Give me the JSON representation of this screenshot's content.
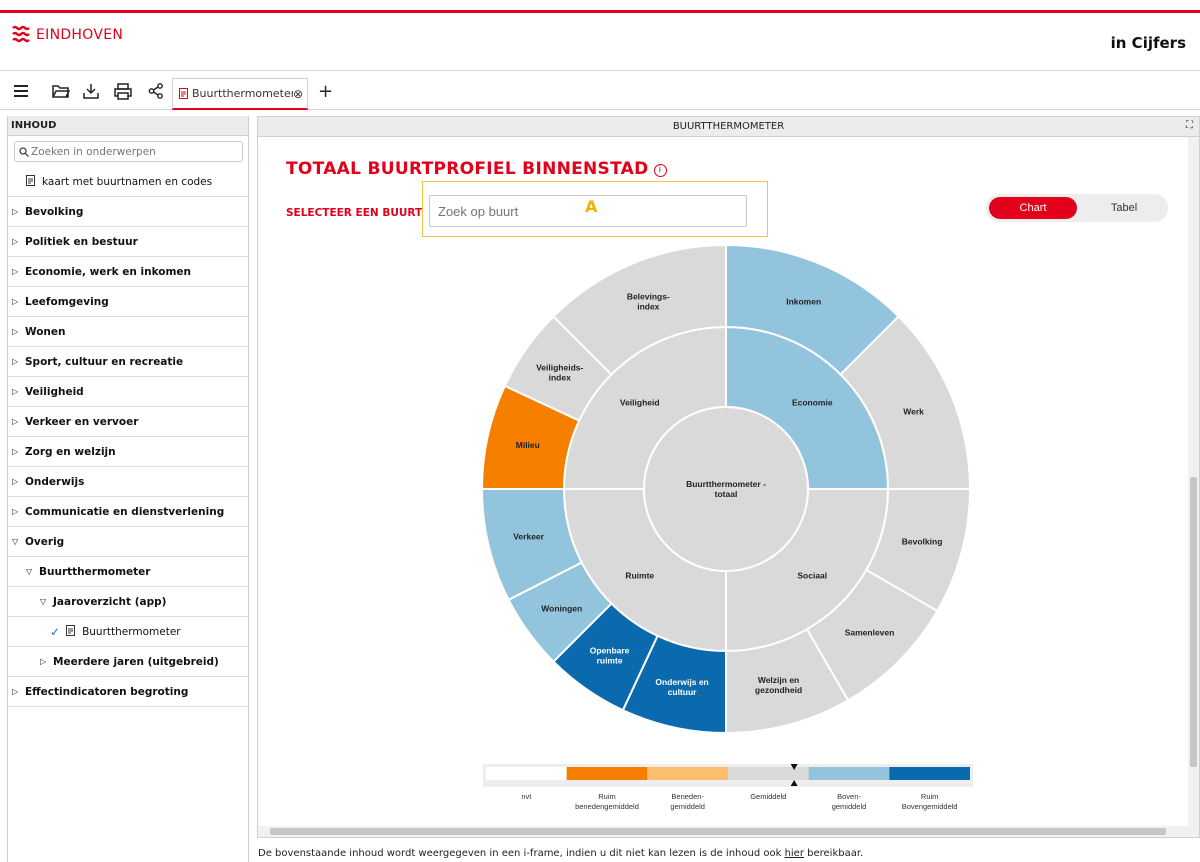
{
  "header": {
    "brand": "EINDHOVEN",
    "right_title": "in Cijfers"
  },
  "toolbar": {
    "icons": [
      "menu-icon",
      "folder-icon",
      "download-icon",
      "print-icon",
      "share-icon"
    ],
    "tab_label": "Buurtthermometer",
    "add_tab": "+"
  },
  "sidebar": {
    "heading": "INHOUD",
    "search_placeholder": "Zoeken in onderwerpen",
    "items": [
      {
        "label": "kaart met buurtnamen en codes",
        "kind": "doc"
      },
      {
        "label": "Bevolking",
        "kind": "collapsed"
      },
      {
        "label": "Politiek en bestuur",
        "kind": "collapsed"
      },
      {
        "label": "Economie, werk en inkomen",
        "kind": "collapsed"
      },
      {
        "label": "Leefomgeving",
        "kind": "collapsed"
      },
      {
        "label": "Wonen",
        "kind": "collapsed"
      },
      {
        "label": "Sport, cultuur en recreatie",
        "kind": "collapsed"
      },
      {
        "label": "Veiligheid",
        "kind": "collapsed"
      },
      {
        "label": "Verkeer en vervoer",
        "kind": "collapsed"
      },
      {
        "label": "Zorg en welzijn",
        "kind": "collapsed"
      },
      {
        "label": "Onderwijs",
        "kind": "collapsed"
      },
      {
        "label": "Communicatie en dienstverlening",
        "kind": "collapsed"
      },
      {
        "label": "Overig",
        "kind": "expanded"
      },
      {
        "label": "Buurtthermometer",
        "kind": "expanded"
      },
      {
        "label": "Jaaroverzicht (app)",
        "kind": "expanded"
      },
      {
        "label": "Buurtthermometer",
        "kind": "selected"
      },
      {
        "label": "Meerdere jaren (uitgebreid)",
        "kind": "collapsed"
      },
      {
        "label": "Effectindicatoren begroting",
        "kind": "collapsed"
      }
    ]
  },
  "panel": {
    "heading": "BUURTTHERMOMETER",
    "title": "TOTAAL BUURTPROFIEL BINNENSTAD",
    "select_label": "SELECTEER EEN BUURT",
    "select_placeholder": "Zoek op buurt",
    "marker": "A",
    "toggle_chart": "Chart",
    "toggle_table": "Tabel"
  },
  "chart_data": {
    "type": "sunburst",
    "center": "Buurtthermometer - totaal",
    "colors": {
      "nvt": "#ffffff",
      "ruim_beneden": "#f77f00",
      "beneden": "#fdbf6f",
      "gemiddeld": "#d9d9d9",
      "boven": "#93c4de",
      "ruim_boven": "#0b6aad"
    },
    "inner": [
      {
        "label": "Economie",
        "start": 0,
        "end": 90,
        "class": "boven"
      },
      {
        "label": "Sociaal",
        "start": 90,
        "end": 180,
        "class": "gemiddeld"
      },
      {
        "label": "Ruimte",
        "start": 180,
        "end": 270,
        "class": "gemiddeld"
      },
      {
        "label": "Veiligheid",
        "start": 270,
        "end": 360,
        "class": "gemiddeld"
      }
    ],
    "outer": [
      {
        "label": "Inkomen",
        "start": 0,
        "end": 45,
        "class": "boven"
      },
      {
        "label": "Werk",
        "start": 45,
        "end": 90,
        "class": "gemiddeld"
      },
      {
        "label": "Bevolking",
        "start": 90,
        "end": 120,
        "class": "gemiddeld"
      },
      {
        "label": "Samenleven",
        "start": 120,
        "end": 150,
        "class": "gemiddeld"
      },
      {
        "label": "Welzijn en gezondheid",
        "start": 150,
        "end": 180,
        "class": "gemiddeld"
      },
      {
        "label": "Onderwijs en cultuur",
        "start": 180,
        "end": 205,
        "class": "ruim_boven"
      },
      {
        "label": "Openbare ruimte",
        "start": 205,
        "end": 225,
        "class": "ruim_boven"
      },
      {
        "label": "Woningen",
        "start": 225,
        "end": 243,
        "class": "boven"
      },
      {
        "label": "Verkeer",
        "start": 243,
        "end": 270,
        "class": "boven"
      },
      {
        "label": "Milieu",
        "start": 270,
        "end": 295,
        "class": "ruim_beneden"
      },
      {
        "label": "Veiligheids-index",
        "start": 295,
        "end": 315,
        "class": "gemiddeld"
      },
      {
        "label": "Belevings-index",
        "start": 315,
        "end": 360,
        "class": "gemiddeld"
      }
    ],
    "legend": [
      {
        "label": "nvt",
        "class": "nvt"
      },
      {
        "label": "Ruim benedengemiddeld",
        "class": "ruim_beneden"
      },
      {
        "label": "Beneden-gemiddeld",
        "class": "beneden"
      },
      {
        "label": "Gemiddeld",
        "class": "gemiddeld"
      },
      {
        "label": "Boven-gemiddeld",
        "class": "boven"
      },
      {
        "label": "Ruim Bovengemiddeld",
        "class": "ruim_boven"
      }
    ],
    "legend_marker_class": "gemiddeld"
  },
  "footer": {
    "text": "De bovenstaande inhoud wordt weergegeven in een i-frame, indien u dit niet kan lezen is de inhoud ook ",
    "link": "hier",
    "suffix": " bereikbaar."
  }
}
